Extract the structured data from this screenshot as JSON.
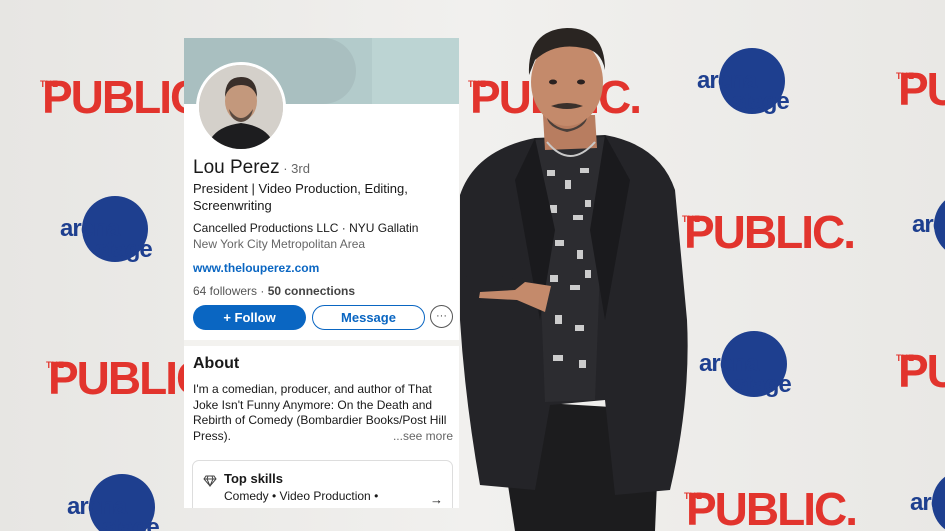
{
  "backdrop": {
    "public_logo": {
      "the": "THE",
      "word": "PUBLIC."
    },
    "arena_logo": {
      "line1": "arena",
      "line2": "stage"
    }
  },
  "profile": {
    "name": "Lou Perez",
    "degree": " · 3rd",
    "headline": "President | Video Production, Editing, Screenwriting",
    "organizations": "Cancelled Productions LLC · NYU Gallatin",
    "location": "New York City Metropolitan Area",
    "website": "www.thelouperez.com",
    "followers": "64 followers",
    "separator": " · ",
    "connections": "50 connections",
    "follow_label": "+ Follow",
    "message_label": "Message",
    "more_label": "···"
  },
  "about": {
    "title": "About",
    "text": "I'm a comedian, producer, and author of That Joke Isn't Funny Anymore: On the Death and Rebirth of Comedy (Bombardier Books/Post Hill Press).",
    "see_more": "...see more"
  },
  "skills": {
    "title": "Top skills",
    "list": "Comedy • Video Production •",
    "arrow": "→"
  },
  "colors": {
    "linkedin_blue": "#0a66c2",
    "public_red": "#e2342d",
    "arena_blue": "#1e3f8f"
  }
}
